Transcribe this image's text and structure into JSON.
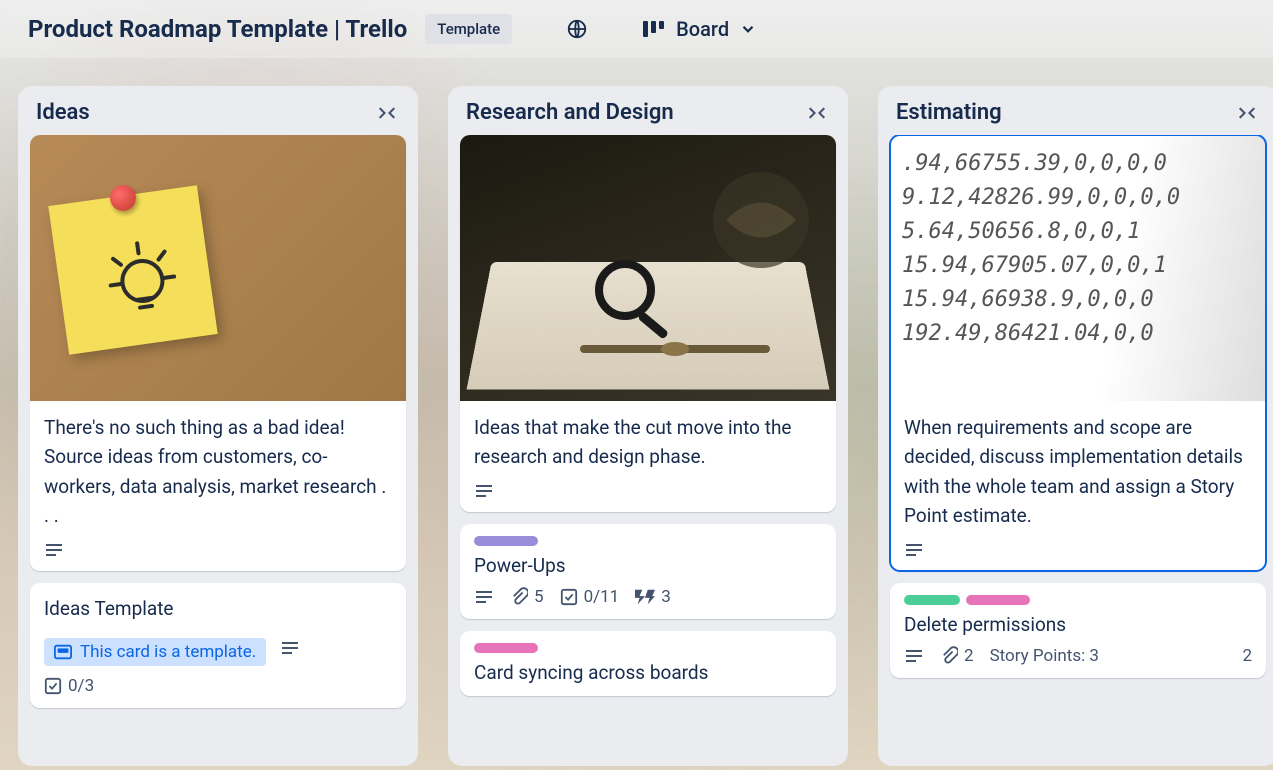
{
  "header": {
    "title": "Product Roadmap Template | Trello",
    "template_chip": "Template",
    "view_label": "Board"
  },
  "lists": [
    {
      "title": "Ideas",
      "cards": [
        {
          "cover": "cork",
          "text": "There's no such thing as a bad idea! Source ideas from customers, co-workers, data analysis, market research . . .",
          "has_description": true
        },
        {
          "title": "Ideas Template",
          "template_badge": "This card is a template.",
          "has_description": true,
          "checklist": "0/3"
        }
      ]
    },
    {
      "title": "Research and Design",
      "cards": [
        {
          "cover": "book",
          "text": "Ideas that make the cut move into the research and design phase.",
          "has_description": true
        },
        {
          "labels": [
            "purple"
          ],
          "title": "Power-Ups",
          "has_description": true,
          "attachments": "5",
          "checklist": "0/11",
          "extra_count": "3"
        },
        {
          "labels": [
            "pink"
          ],
          "title": "Card syncing across boards"
        }
      ]
    },
    {
      "title": "Estimating",
      "cards": [
        {
          "cover": "numbers",
          "selected": true,
          "text": "When requirements and scope are decided, discuss implementation details with the whole team and assign a Story Point estimate.",
          "has_description": true,
          "numbers_lines": [
            ".94,66755.39,0,0,0,0",
            "9.12,42826.99,0,0,0,0",
            "5.64,50656.8,0,0,1",
            "15.94,67905.07,0,0,1",
            "15.94,66938.9,0,0,0",
            "192.49,86421.04,0,0"
          ]
        },
        {
          "labels": [
            "green",
            "pink"
          ],
          "title": "Delete permissions",
          "has_description": true,
          "attachments": "2",
          "story_points_label": "Story Points: 3",
          "extra_count": "2"
        }
      ]
    }
  ]
}
